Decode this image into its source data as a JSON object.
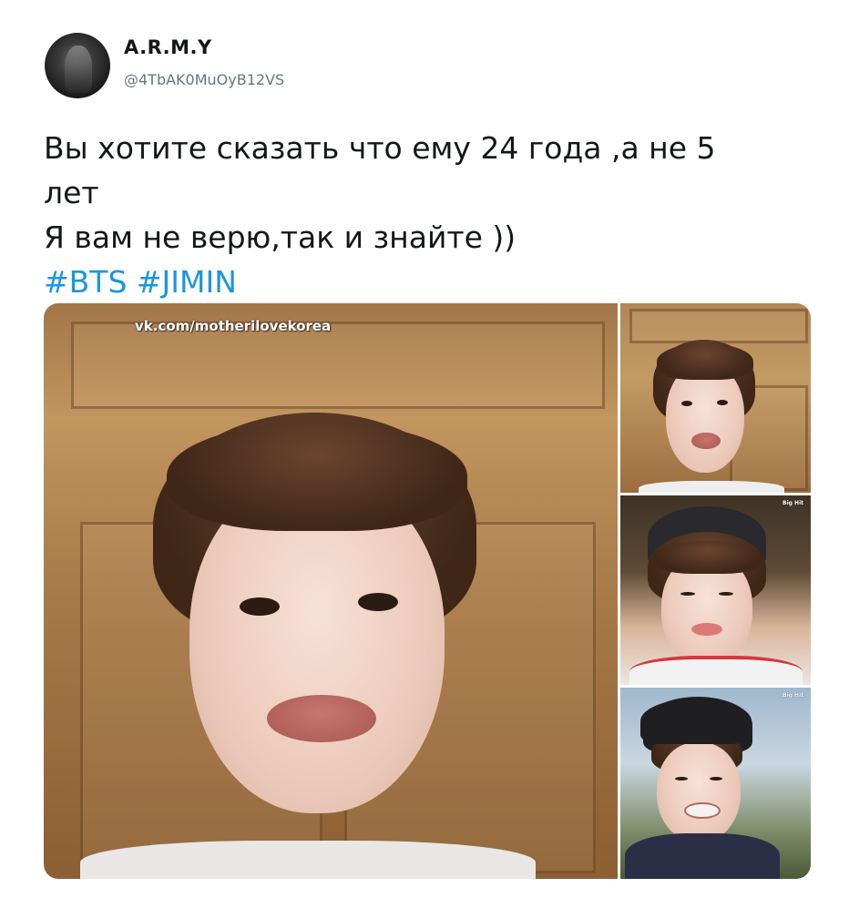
{
  "author": {
    "display_name": "A.R.M.Y",
    "handle": "@4TbAK0MuOyB12VS"
  },
  "tweet": {
    "lines": [
      "Вы хотите сказать что ему 24 года ,а не 5",
      "лет",
      "Я вам не верю,так и знайте ))"
    ],
    "hashtags": [
      "#BTS",
      "#JIMIN"
    ]
  },
  "media": {
    "watermark": "vk.com/motherilovekorea",
    "photo_logo": "Big Hit"
  },
  "colors": {
    "hashtag": "#1b95e0",
    "handle": "#657786",
    "text": "#14171a"
  }
}
